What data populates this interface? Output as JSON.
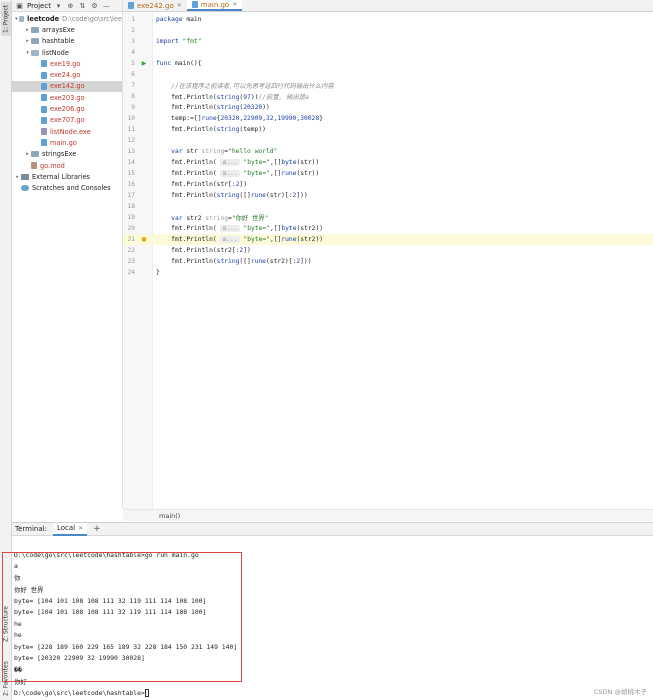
{
  "tool_strip": {
    "project_label": "1: Project",
    "structure_label": "Z: Structure",
    "favorites_label": "2: Favorites"
  },
  "project_panel": {
    "title": "Project",
    "tree": [
      {
        "label": "leetcode",
        "suffix": "D:\\code\\go\\src\\lee",
        "kind": "folder-open",
        "indent": 0,
        "arrow": "▾",
        "bold": true
      },
      {
        "label": "arraysExe",
        "kind": "folder",
        "indent": 1,
        "arrow": "▸"
      },
      {
        "label": "hashtable",
        "kind": "folder",
        "indent": 1,
        "arrow": "▸"
      },
      {
        "label": "listNode",
        "kind": "folder-open",
        "indent": 1,
        "arrow": "▾"
      },
      {
        "label": "exe19.go",
        "kind": "go",
        "indent": 2,
        "red": true
      },
      {
        "label": "exe24.go",
        "kind": "go",
        "indent": 2,
        "red": true
      },
      {
        "label": "exe142.go",
        "kind": "go",
        "indent": 2,
        "red": true,
        "selected": true
      },
      {
        "label": "exe203.go",
        "kind": "go",
        "indent": 2,
        "red": true
      },
      {
        "label": "exe206.go",
        "kind": "go",
        "indent": 2,
        "red": true
      },
      {
        "label": "exe707.go",
        "kind": "go",
        "indent": 2,
        "red": true
      },
      {
        "label": "listNode.exe",
        "kind": "exe",
        "indent": 2,
        "red": true
      },
      {
        "label": "main.go",
        "kind": "go",
        "indent": 2,
        "red": true
      },
      {
        "label": "stringsExe",
        "kind": "folder",
        "indent": 1,
        "arrow": "▸"
      },
      {
        "label": "go.mod",
        "kind": "mod",
        "indent": 1,
        "red": true
      },
      {
        "label": "External Libraries",
        "kind": "lib",
        "indent": 0,
        "arrow": "▸"
      },
      {
        "label": "Scratches and Consoles",
        "kind": "scratch",
        "indent": 0
      }
    ]
  },
  "editor": {
    "tabs": [
      {
        "label": "exe242.go",
        "active": false
      },
      {
        "label": "main.go",
        "active": true
      }
    ],
    "breadcrumb": "main()",
    "lines": [
      {
        "n": "1",
        "html": "<span class='kw'>package</span> main"
      },
      {
        "n": "2",
        "html": ""
      },
      {
        "n": "3",
        "html": "<span class='kw'>import</span> <span class='str'>\"fmt\"</span>"
      },
      {
        "n": "4",
        "html": ""
      },
      {
        "n": "5",
        "html": "<span class='kw'>func</span> main(){",
        "run": true
      },
      {
        "n": "6",
        "html": ""
      },
      {
        "n": "7",
        "html": "    <span class='cmt'>//在该程序之前读者,可以先思考这四行代码输出什么内容</span>"
      },
      {
        "n": "8",
        "html": "    fmt.Println(<span class='kw'>string</span>(<span class='num'>97</span>))<span class='cmt'>//前置, 输出是a</span>"
      },
      {
        "n": "9",
        "html": "    fmt.Println(<span class='kw'>string</span>(<span class='num'>20320</span>))"
      },
      {
        "n": "10",
        "html": "    temp:=[]<span class='kw'>rune</span>{<span class='num'>20320</span>,<span class='num'>22909</span>,<span class='num'>32</span>,<span class='num'>19990</span>,<span class='num'>30028</span>}"
      },
      {
        "n": "11",
        "html": "    fmt.Println(<span class='kw'>string</span>(temp))"
      },
      {
        "n": "12",
        "html": ""
      },
      {
        "n": "13",
        "html": "    <span class='kw'>var</span> str <span class='typehint'>string</span>=<span class='str'>\"hello world\"</span>"
      },
      {
        "n": "14",
        "html": "    fmt.Println( <span class='hint'>a...</span> <span class='str'>\"byte=\"</span>,[]<span class='kw'>byte</span>(str))"
      },
      {
        "n": "15",
        "html": "    fmt.Println( <span class='hint'>a...</span> <span class='str'>\"byte=\"</span>,[]<span class='kw'>rune</span>(str))"
      },
      {
        "n": "16",
        "html": "    fmt.Println(str[:<span class='num'>2</span>])"
      },
      {
        "n": "17",
        "html": "    fmt.Println(<span class='kw'>string</span>([]<span class='kw'>rune</span>(str)[:<span class='num'>2</span>]))"
      },
      {
        "n": "18",
        "html": ""
      },
      {
        "n": "19",
        "html": "    <span class='kw'>var</span> str2 <span class='typehint'>string</span>=<span class='str'>\"你好 世界\"</span>"
      },
      {
        "n": "20",
        "html": "    fmt.Println( <span class='hint'>a...</span> <span class='str'>\"byte=\"</span>,[]<span class='kw'>byte</span>(str2))"
      },
      {
        "n": "21",
        "html": "    fmt.Println( <span class='hint'>a...</span> <span class='str'>\"byte=\"</span>,[]<span class='kw'>rune</span>(str2))",
        "current": true,
        "bulb": true
      },
      {
        "n": "22",
        "html": "    fmt.Println(str2[:<span class='num'>2</span>])"
      },
      {
        "n": "23",
        "html": "    fmt.Println(<span class='kw'>string</span>([]<span class='kw'>rune</span>(str2)[:<span class='num'>2</span>]))"
      },
      {
        "n": "24",
        "html": "}"
      }
    ]
  },
  "terminal": {
    "title": "Terminal:",
    "tab_label": "Local",
    "add_label": "+",
    "prompt_line": "D:\\code\\go\\src\\leetcode\\hashtable>go run main.go",
    "output": [
      "a",
      "你",
      "你好 世界",
      "byte= [104 101 108 108 111 32 119 111 114 108 100]",
      "byte= [104 101 108 108 111 32 119 111 114 108 100]",
      "he",
      "he",
      "byte= [228 189 160 229 165 189 32 228 184 150 231 149 140]",
      "byte= [20320 22909 32 19990 30028]",
      "��",
      "你好"
    ],
    "final_prompt": "D:\\code\\go\\src\\leetcode\\hashtable>"
  },
  "watermark": "CSDN @胡桃木子"
}
